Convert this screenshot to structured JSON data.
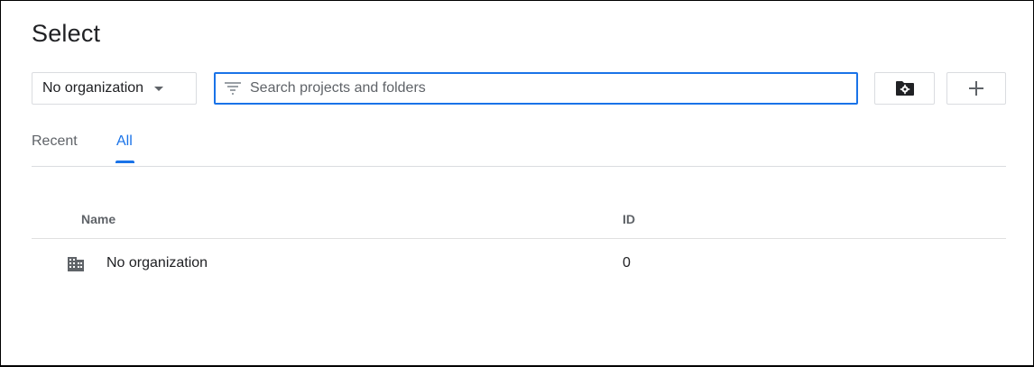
{
  "dialog": {
    "title": "Select"
  },
  "toolbar": {
    "org_select_value": "No organization",
    "search_placeholder": "Search projects and folders",
    "folder_button_icon": "folder-settings-icon",
    "add_button_icon": "plus-icon"
  },
  "tabs": [
    {
      "label": "Recent",
      "active": false
    },
    {
      "label": "All",
      "active": true
    }
  ],
  "table": {
    "headers": {
      "name": "Name",
      "id": "ID"
    },
    "rows": [
      {
        "icon": "building-icon",
        "name": "No organization",
        "id": "0"
      }
    ]
  },
  "colors": {
    "accent": "#1a73e8",
    "border": "#dadce0",
    "text": "#202124",
    "muted": "#5f6368"
  }
}
